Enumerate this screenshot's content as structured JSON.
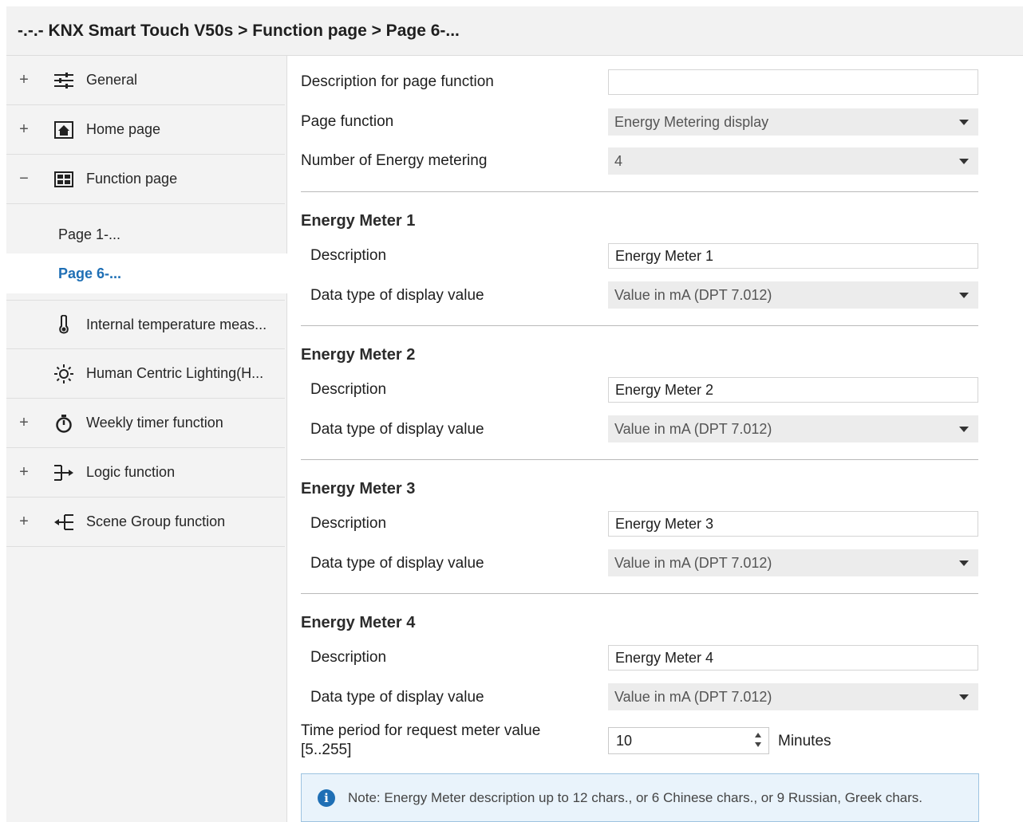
{
  "title": "-.-.- KNX Smart Touch V50s > Function page > Page 6-...",
  "sidebar": {
    "items": [
      {
        "expander": "+",
        "icon": "sliders-icon",
        "label": "General"
      },
      {
        "expander": "+",
        "icon": "home-icon",
        "label": "Home page"
      },
      {
        "expander": "−",
        "icon": "grid-icon",
        "label": "Function page"
      },
      {
        "expander": "",
        "icon": "thermometer-icon",
        "label": "Internal temperature meas..."
      },
      {
        "expander": "",
        "icon": "sun-icon",
        "label": "Human Centric Lighting(H..."
      },
      {
        "expander": "+",
        "icon": "timer-icon",
        "label": "Weekly timer function"
      },
      {
        "expander": "+",
        "icon": "logic-icon",
        "label": "Logic function"
      },
      {
        "expander": "+",
        "icon": "scene-icon",
        "label": "Scene Group function"
      }
    ],
    "subitems": [
      {
        "label": "Page 1-..."
      },
      {
        "label": "Page 6-..."
      }
    ]
  },
  "form": {
    "desc_label": "Description for page function",
    "desc_value": "",
    "page_function_label": "Page function",
    "page_function_value": "Energy Metering display",
    "num_label": "Number of Energy metering",
    "num_value": "4",
    "meters": [
      {
        "title": "Energy Meter 1",
        "desc_label": "Description",
        "desc_value": "Energy Meter 1",
        "type_label": "Data type of display value",
        "type_value": "Value in mA (DPT 7.012)"
      },
      {
        "title": "Energy Meter 2",
        "desc_label": "Description",
        "desc_value": "Energy Meter 2",
        "type_label": "Data type of display value",
        "type_value": "Value in mA (DPT 7.012)"
      },
      {
        "title": "Energy Meter 3",
        "desc_label": "Description",
        "desc_value": "Energy Meter 3",
        "type_label": "Data type of display value",
        "type_value": "Value in mA (DPT 7.012)"
      },
      {
        "title": "Energy Meter 4",
        "desc_label": "Description",
        "desc_value": "Energy Meter 4",
        "type_label": "Data type of display value",
        "type_value": "Value in mA (DPT 7.012)"
      }
    ],
    "period_label_line1": "Time period for request meter value",
    "period_label_line2": "[5..255]",
    "period_value": "10",
    "period_unit": "Minutes",
    "note": "Note: Energy Meter description up to 12 chars., or 6 Chinese chars., or 9 Russian, Greek chars."
  },
  "colors": {
    "accent": "#1f6fb5",
    "note_bg": "#e9f3fb"
  }
}
